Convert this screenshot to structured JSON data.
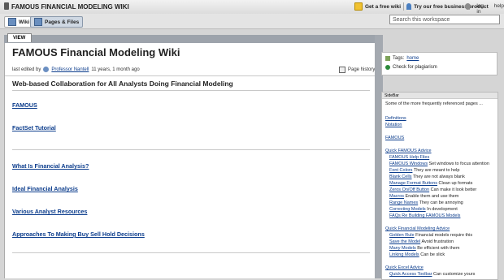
{
  "header": {
    "workspace_title": "FAMOUS FINANCIAL MODELING WIKI",
    "promo_free_wiki": "Get a free wiki",
    "promo_business": "Try our free business product",
    "login": "log in",
    "help": "help"
  },
  "nav": {
    "tab_wiki": "Wiki",
    "tab_pages": "Pages & Files",
    "search_placeholder": "Search this workspace"
  },
  "view_tab": "VIEW",
  "page": {
    "title": "FAMOUS Financial Modeling Wiki",
    "last_edited_prefix": "last edited by",
    "editor": "Professor Nantell",
    "edited_ago": "11 years, 1 month ago",
    "page_history": "Page history",
    "subtitle": "Web-based Collaboration for All Analysts Doing Financial Modeling",
    "links": [
      "FAMOUS",
      "FactSet Tutorial",
      "What Is Financial Analysis?",
      "Ideal Financial Analysis",
      "Various Analyst Resources",
      "Approaches To Making Buy Sell Hold Decisions"
    ]
  },
  "tags": {
    "label": "Tags:",
    "tag": "home",
    "plagiarism": "Check for plagiarism"
  },
  "sidebar": {
    "heading": "SideBar",
    "intro": "Some of the more frequently referenced pages ...",
    "items": [
      {
        "link": "Definitions",
        "text": "",
        "indent": false
      },
      {
        "link": "Notation",
        "text": "",
        "indent": false
      },
      {
        "link": "FAMOUS",
        "text": "",
        "indent": false
      },
      {
        "link": "Quick FAMOUS Advice",
        "text": "",
        "indent": false
      },
      {
        "link": "FAMOUS Help Files",
        "text": "",
        "indent": true
      },
      {
        "link": "FAMOUS Windows",
        "text": "Set windows to focus attention",
        "indent": true
      },
      {
        "link": "Font Colors",
        "text": "They are meant to help",
        "indent": true
      },
      {
        "link": "Blank Cells",
        "text": "They are not always blank",
        "indent": true
      },
      {
        "link": "Manage Format Buttons",
        "text": "Clean up formats",
        "indent": true
      },
      {
        "link": "Zeros On/Off Button",
        "text": "Can make it look better",
        "indent": true
      },
      {
        "link": "Macros",
        "text": "Enable them and use them",
        "indent": true
      },
      {
        "link": "Range Names",
        "text": "They can be annoying",
        "indent": true
      },
      {
        "link": "Correcting Models",
        "text": "In development",
        "indent": true
      },
      {
        "link": "FAQs Re Building FAMOUS Models",
        "text": "",
        "indent": true
      },
      {
        "link": "Quick Financial Modeling Advice",
        "text": "",
        "indent": false
      },
      {
        "link": "Golden Rule",
        "text": "Financial models require this",
        "indent": true
      },
      {
        "link": "Save the Model",
        "text": "Avoid frustration",
        "indent": true
      },
      {
        "link": "Many Models",
        "text": "Be efficient with them",
        "indent": true
      },
      {
        "link": "Linking Models",
        "text": "Can be slick",
        "indent": true
      },
      {
        "link": "Quick Excel Advice",
        "text": "",
        "indent": false
      },
      {
        "link": "Quick Access Toolbar",
        "text": "Can customize yours",
        "indent": true
      }
    ]
  }
}
